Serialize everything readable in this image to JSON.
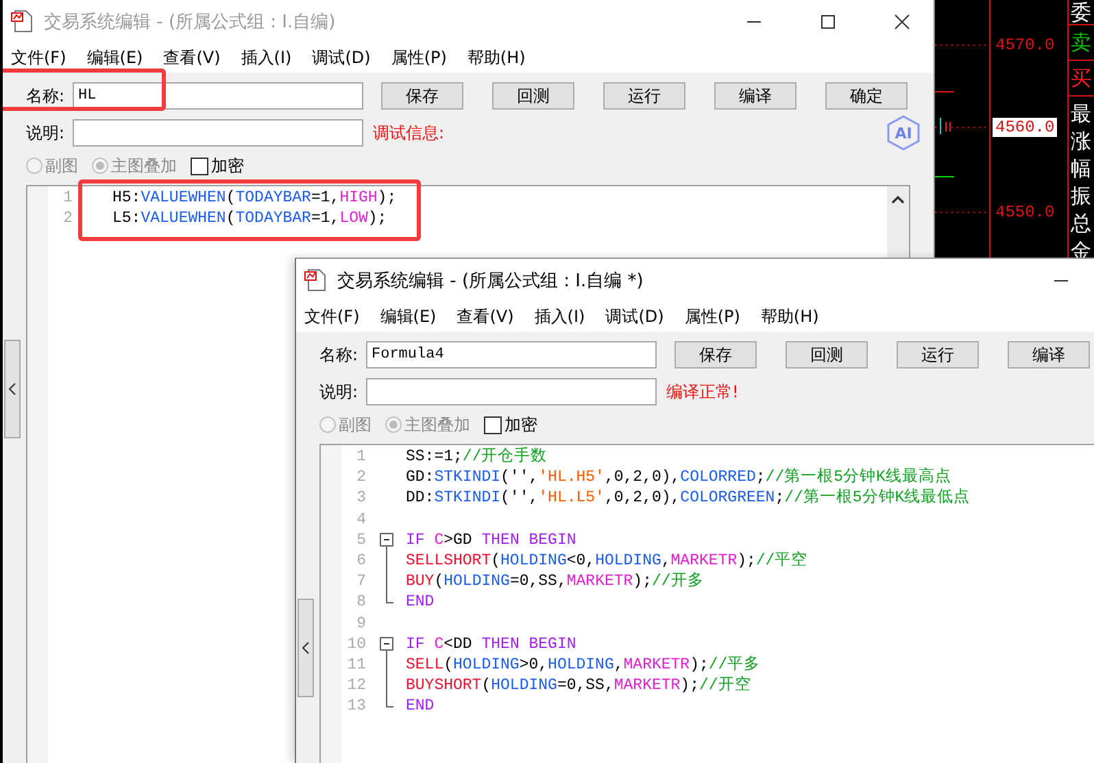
{
  "chart": {
    "price_labels": [
      {
        "text": "4570.0",
        "current": false
      },
      {
        "text": "4560.0",
        "current": true
      },
      {
        "text": "4550.0",
        "current": false
      }
    ],
    "side_labels": [
      {
        "text": "委",
        "color": "#ffffff"
      },
      {
        "text": "卖",
        "color": "#00c000"
      },
      {
        "text": "买",
        "color": "#ff2020"
      },
      {
        "text": "最",
        "color": "#ffffff"
      },
      {
        "text": "涨",
        "color": "#ffffff"
      },
      {
        "text": "幅",
        "color": "#ffffff"
      },
      {
        "text": "振",
        "color": "#ffffff"
      },
      {
        "text": "总",
        "color": "#ffffff"
      },
      {
        "text": "金",
        "color": "#ffffff"
      }
    ]
  },
  "windows": [
    {
      "title": "交易系统编辑 - (所属公式组 : I.自编)",
      "active": false,
      "cut_off": false,
      "menu": [
        "文件(F)",
        "编辑(E)",
        "查看(V)",
        "插入(I)",
        "调试(D)",
        "属性(P)",
        "帮助(H)"
      ],
      "name_field": {
        "label": "名称:",
        "value": "HL",
        "highlighted": true
      },
      "buttons": [
        "保存",
        "回测",
        "运行",
        "编译",
        "确定"
      ],
      "description_field": {
        "label": "说明:"
      },
      "status": "调试信息:",
      "ai_badge": "AI",
      "options": [
        {
          "kind": "radio",
          "label": "副图",
          "selected": false,
          "disabled": true
        },
        {
          "kind": "radio",
          "label": "主图叠加",
          "selected": true,
          "disabled": true
        },
        {
          "kind": "checkbox",
          "label": "加密",
          "checked": false
        }
      ],
      "editor": {
        "highlighted": true,
        "lines": [
          {
            "number": "1",
            "tokens": [
              {
                "kind": "text",
                "text": "H5:"
              },
              {
                "kind": "func",
                "text": "VALUEWHEN"
              },
              {
                "kind": "text",
                "text": "("
              },
              {
                "kind": "func",
                "text": "TODAYBAR"
              },
              {
                "kind": "text",
                "text": "=1,"
              },
              {
                "kind": "const",
                "text": "HIGH"
              },
              {
                "kind": "text",
                "text": ");"
              }
            ]
          },
          {
            "number": "2",
            "tokens": [
              {
                "kind": "text",
                "text": "L5:"
              },
              {
                "kind": "func",
                "text": "VALUEWHEN"
              },
              {
                "kind": "text",
                "text": "("
              },
              {
                "kind": "func",
                "text": "TODAYBAR"
              },
              {
                "kind": "text",
                "text": "=1,"
              },
              {
                "kind": "const",
                "text": "LOW"
              },
              {
                "kind": "text",
                "text": ");"
              }
            ]
          }
        ]
      }
    },
    {
      "title": "交易系统编辑 - (所属公式组 : I.自编 *)",
      "active": true,
      "cut_off": true,
      "menu": [
        "文件(F)",
        "编辑(E)",
        "查看(V)",
        "插入(I)",
        "调试(D)",
        "属性(P)",
        "帮助(H)"
      ],
      "name_field": {
        "label": "名称:",
        "value": "Formula4",
        "highlighted": false
      },
      "buttons": [
        "保存",
        "回测",
        "运行",
        "编译"
      ],
      "description_field": {
        "label": "说明:"
      },
      "status": "编译正常!",
      "options": [
        {
          "kind": "radio",
          "label": "副图",
          "selected": false,
          "disabled": true
        },
        {
          "kind": "radio",
          "label": "主图叠加",
          "selected": true,
          "disabled": true
        },
        {
          "kind": "checkbox",
          "label": "加密",
          "checked": false
        }
      ],
      "editor": {
        "highlighted": false,
        "lines": [
          {
            "number": "1",
            "kind": "plain",
            "tokens": [
              {
                "kind": "text",
                "text": "SS:=1;"
              },
              {
                "kind": "comment",
                "text": "//开仓手数"
              }
            ]
          },
          {
            "number": "2",
            "kind": "plain",
            "tokens": [
              {
                "kind": "text",
                "text": "GD:"
              },
              {
                "kind": "func",
                "text": "STKINDI"
              },
              {
                "kind": "text",
                "text": "('',"
              },
              {
                "kind": "string",
                "text": "'HL.H5'"
              },
              {
                "kind": "text",
                "text": ",0,2,0),"
              },
              {
                "kind": "func",
                "text": "COLORRED"
              },
              {
                "kind": "text",
                "text": ";"
              },
              {
                "kind": "comment",
                "text": "//第一根5分钟K线最高点"
              }
            ]
          },
          {
            "number": "3",
            "kind": "plain",
            "tokens": [
              {
                "kind": "text",
                "text": "DD:"
              },
              {
                "kind": "func",
                "text": "STKINDI"
              },
              {
                "kind": "text",
                "text": "('',"
              },
              {
                "kind": "string",
                "text": "'HL.L5'"
              },
              {
                "kind": "text",
                "text": ",0,2,0),"
              },
              {
                "kind": "func",
                "text": "COLORGREEN"
              },
              {
                "kind": "text",
                "text": ";"
              },
              {
                "kind": "comment",
                "text": "//第一根5分钟K线最低点"
              }
            ]
          },
          {
            "number": "4",
            "kind": "plain"
          },
          {
            "number": "5",
            "kind": "start",
            "tokens": [
              {
                "kind": "keyword",
                "text": "IF "
              },
              {
                "kind": "const",
                "text": "C"
              },
              {
                "kind": "text",
                "text": ">GD "
              },
              {
                "kind": "keyword",
                "text": "THEN BEGIN"
              }
            ]
          },
          {
            "number": "6",
            "kind": "mid",
            "tokens": [
              {
                "kind": "trade",
                "text": "SELLSHORT"
              },
              {
                "kind": "text",
                "text": "("
              },
              {
                "kind": "func",
                "text": "HOLDING"
              },
              {
                "kind": "text",
                "text": "<0,"
              },
              {
                "kind": "func",
                "text": "HOLDING"
              },
              {
                "kind": "text",
                "text": ","
              },
              {
                "kind": "const",
                "text": "MARKETR"
              },
              {
                "kind": "text",
                "text": ");"
              },
              {
                "kind": "comment",
                "text": "//平空"
              }
            ]
          },
          {
            "number": "7",
            "kind": "mid",
            "tokens": [
              {
                "kind": "trade",
                "text": "BUY"
              },
              {
                "kind": "text",
                "text": "("
              },
              {
                "kind": "func",
                "text": "HOLDING"
              },
              {
                "kind": "text",
                "text": "=0,SS,"
              },
              {
                "kind": "const",
                "text": "MARKETR"
              },
              {
                "kind": "text",
                "text": ");"
              },
              {
                "kind": "comment",
                "text": "//开多"
              }
            ]
          },
          {
            "number": "8",
            "kind": "end",
            "tokens": [
              {
                "kind": "keyword",
                "text": "END"
              }
            ]
          },
          {
            "number": "9",
            "kind": "plain"
          },
          {
            "number": "10",
            "kind": "start",
            "tokens": [
              {
                "kind": "keyword",
                "text": "IF "
              },
              {
                "kind": "const",
                "text": "C"
              },
              {
                "kind": "text",
                "text": "<DD "
              },
              {
                "kind": "keyword",
                "text": "THEN BEGIN"
              }
            ]
          },
          {
            "number": "11",
            "kind": "mid",
            "tokens": [
              {
                "kind": "trade",
                "text": "SELL"
              },
              {
                "kind": "text",
                "text": "("
              },
              {
                "kind": "func",
                "text": "HOLDING"
              },
              {
                "kind": "text",
                "text": ">0,"
              },
              {
                "kind": "func",
                "text": "HOLDING"
              },
              {
                "kind": "text",
                "text": ","
              },
              {
                "kind": "const",
                "text": "MARKETR"
              },
              {
                "kind": "text",
                "text": ");"
              },
              {
                "kind": "comment",
                "text": "//平多"
              }
            ]
          },
          {
            "number": "12",
            "kind": "mid",
            "tokens": [
              {
                "kind": "trade",
                "text": "BUYSHORT"
              },
              {
                "kind": "text",
                "text": "("
              },
              {
                "kind": "func",
                "text": "HOLDING"
              },
              {
                "kind": "text",
                "text": "=0,SS,"
              },
              {
                "kind": "const",
                "text": "MARKETR"
              },
              {
                "kind": "text",
                "text": ");"
              },
              {
                "kind": "comment",
                "text": "//开空"
              }
            ]
          },
          {
            "number": "13",
            "kind": "end",
            "tokens": [
              {
                "kind": "keyword",
                "text": "END"
              }
            ]
          }
        ]
      }
    }
  ]
}
